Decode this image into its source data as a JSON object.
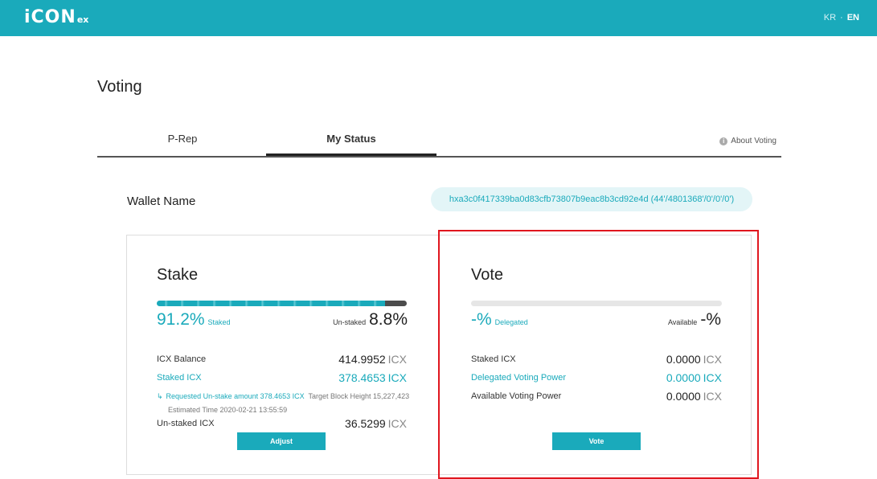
{
  "header": {
    "logo_text": "iCON",
    "logo_sub": "ex",
    "lang_kr": "KR",
    "lang_sep": "·",
    "lang_en": "EN",
    "bar_color": "#1aaabb"
  },
  "page": {
    "title": "Voting"
  },
  "tabs": [
    {
      "label": "P-Rep",
      "active": false
    },
    {
      "label": "My Status",
      "active": true
    }
  ],
  "about": {
    "icon": "info-icon",
    "label": "About Voting"
  },
  "wallet": {
    "name_label": "Wallet Name",
    "address": "hxa3c0f417339ba0d83cfb73807b9eac8b3cd92e4d (44'/4801368'/0'/0'/0')"
  },
  "stake": {
    "title": "Stake",
    "staked_pct": "91.2%",
    "staked_pct_value": 91.2,
    "staked_label": "Staked",
    "unstaked_label": "Un-staked",
    "unstaked_pct": "8.8%",
    "rows": [
      {
        "label": "ICX Balance",
        "value": "414.9952",
        "unit": "ICX"
      },
      {
        "label": "Staked ICX",
        "value": "378.4653",
        "unit": "ICX"
      }
    ],
    "request": {
      "label": "Requested Un-stake amount 378.4653 ICX",
      "target": "Target Block Height 15,227,423",
      "estimated": "Estimated Time 2020-02-21 13:55:59"
    },
    "unstaked_row": {
      "label": "Un-staked ICX",
      "value": "36.5299",
      "unit": "ICX"
    },
    "button": "Adjust"
  },
  "vote": {
    "title": "Vote",
    "delegated_pct": "-%",
    "delegated_label": "Delegated",
    "available_label": "Available",
    "available_pct": "-%",
    "rows": [
      {
        "label": "Staked ICX",
        "value": "0.0000",
        "unit": "ICX"
      },
      {
        "label": "Delegated Voting Power",
        "value": "0.0000",
        "unit": "ICX"
      },
      {
        "label": "Available Voting Power",
        "value": "0.0000",
        "unit": "ICX"
      }
    ],
    "button": "Vote"
  },
  "highlight_color": "#e0161e"
}
